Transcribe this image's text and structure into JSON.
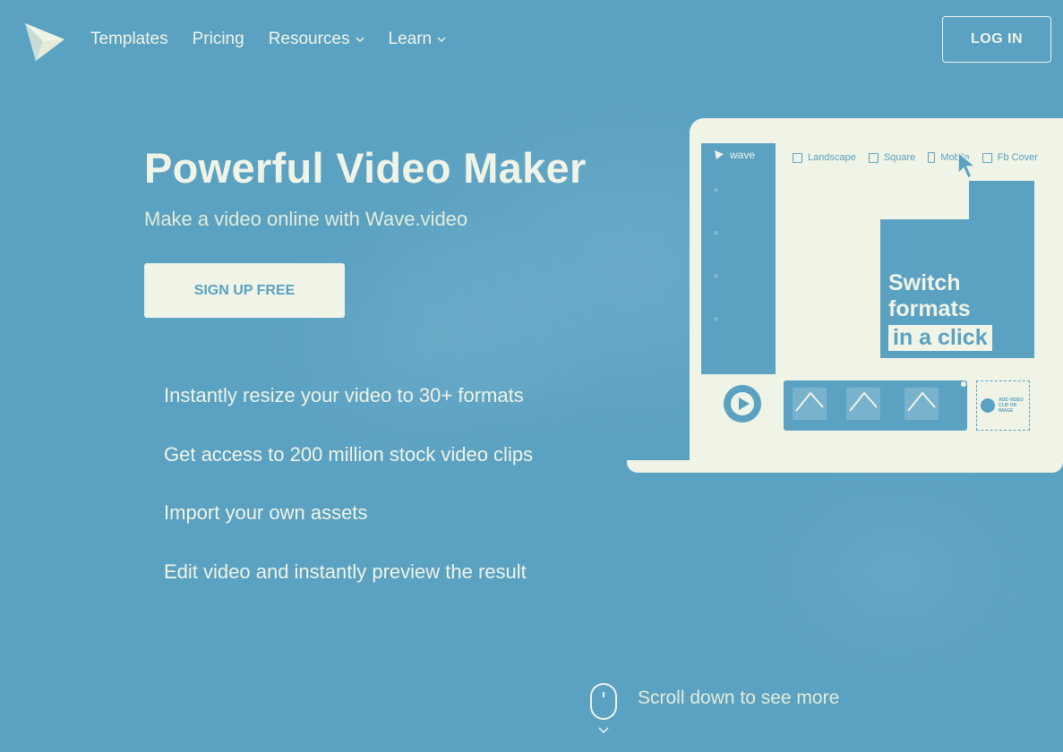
{
  "nav": {
    "items": [
      {
        "label": "Templates"
      },
      {
        "label": "Pricing"
      },
      {
        "label": "Resources"
      },
      {
        "label": "Learn"
      }
    ],
    "login_label": "LOG IN"
  },
  "hero": {
    "title": "Powerful Video Maker",
    "subtitle": "Make a video online with Wave.video",
    "signup_label": "SIGN UP FREE",
    "features": [
      "Instantly resize your video to 30+ formats",
      "Get access to 200 million stock video clips",
      "Import your own assets",
      "Edit video and instantly preview the result"
    ]
  },
  "laptop": {
    "app_name": "wave",
    "formats": [
      "Landscape",
      "Square",
      "Mobile",
      "Fb Cover"
    ],
    "preview_line1": "Switch",
    "preview_line2": "formats",
    "preview_line3": "in a click",
    "add_clip_label": "ADD VIDEO CLIP OR IMAGE"
  },
  "scroll_hint": "Scroll down to see more",
  "colors": {
    "background": "#5aa1c2",
    "foreground": "#f0f4e6"
  }
}
